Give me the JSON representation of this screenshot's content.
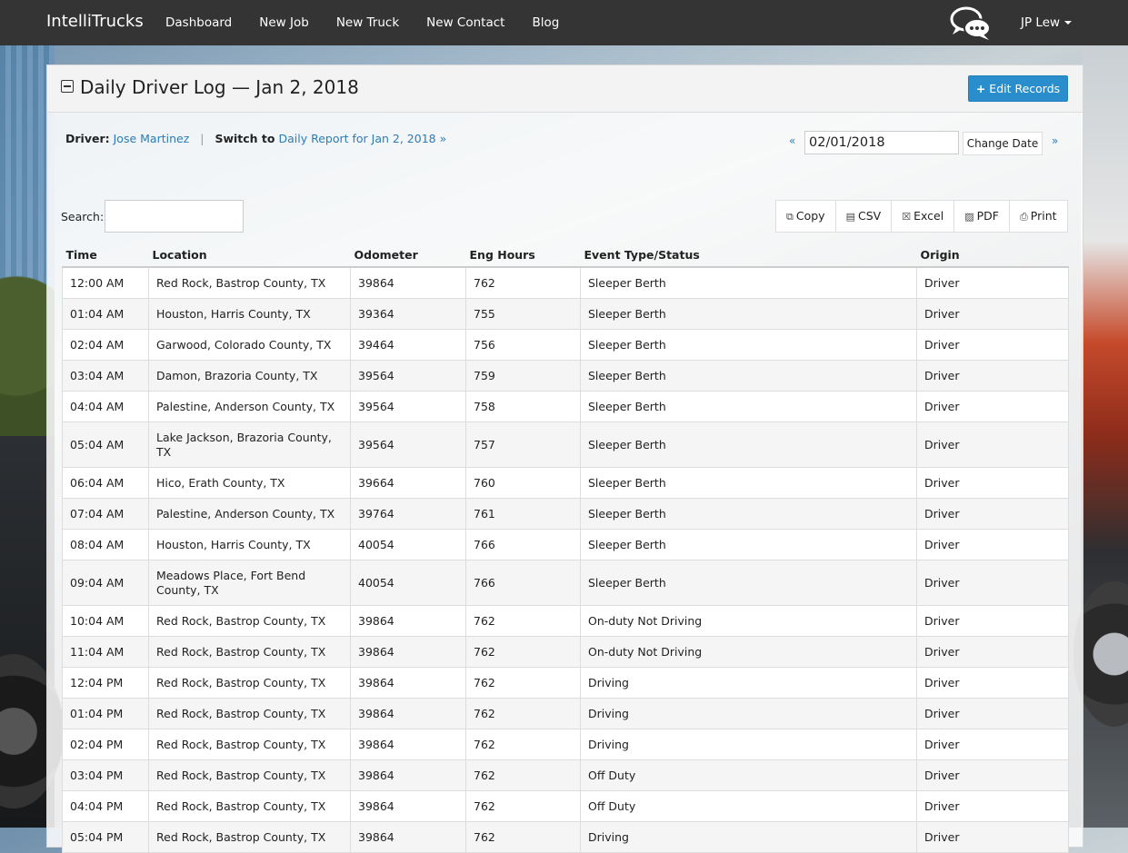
{
  "nav": {
    "brand": "IntelliTrucks",
    "links": [
      "Dashboard",
      "New Job",
      "New Truck",
      "New Contact",
      "Blog"
    ],
    "user": "JP Lew"
  },
  "panel": {
    "title": "Daily Driver Log — Jan 2, 2018",
    "edit_button": "Edit Records"
  },
  "driver": {
    "label": "Driver:",
    "name": "Jose Martinez",
    "switch_label": "Switch to",
    "switch_link": "Daily Report for Jan 2, 2018 »"
  },
  "date_nav": {
    "prev": "«",
    "value": "02/01/2018",
    "change_button": "Change Date",
    "next": "»"
  },
  "search": {
    "label": "Search:"
  },
  "export": [
    "Copy",
    "CSV",
    "Excel",
    "PDF",
    "Print"
  ],
  "table": {
    "columns": [
      "Time",
      "Location",
      "Odometer",
      "Eng Hours",
      "Event Type/Status",
      "Origin"
    ],
    "rows": [
      [
        "12:00 AM",
        "Red Rock, Bastrop County, TX",
        "39864",
        "762",
        "Sleeper Berth",
        "Driver"
      ],
      [
        "01:04 AM",
        "Houston, Harris County, TX",
        "39364",
        "755",
        "Sleeper Berth",
        "Driver"
      ],
      [
        "02:04 AM",
        "Garwood, Colorado County, TX",
        "39464",
        "756",
        "Sleeper Berth",
        "Driver"
      ],
      [
        "03:04 AM",
        "Damon, Brazoria County, TX",
        "39564",
        "759",
        "Sleeper Berth",
        "Driver"
      ],
      [
        "04:04 AM",
        "Palestine, Anderson County, TX",
        "39564",
        "758",
        "Sleeper Berth",
        "Driver"
      ],
      [
        "05:04 AM",
        "Lake Jackson, Brazoria County, TX",
        "39564",
        "757",
        "Sleeper Berth",
        "Driver"
      ],
      [
        "06:04 AM",
        "Hico, Erath County, TX",
        "39664",
        "760",
        "Sleeper Berth",
        "Driver"
      ],
      [
        "07:04 AM",
        "Palestine, Anderson County, TX",
        "39764",
        "761",
        "Sleeper Berth",
        "Driver"
      ],
      [
        "08:04 AM",
        "Houston, Harris County, TX",
        "40054",
        "766",
        "Sleeper Berth",
        "Driver"
      ],
      [
        "09:04 AM",
        "Meadows Place, Fort Bend County, TX",
        "40054",
        "766",
        "Sleeper Berth",
        "Driver"
      ],
      [
        "10:04 AM",
        "Red Rock, Bastrop County, TX",
        "39864",
        "762",
        "On-duty Not Driving",
        "Driver"
      ],
      [
        "11:04 AM",
        "Red Rock, Bastrop County, TX",
        "39864",
        "762",
        "On-duty Not Driving",
        "Driver"
      ],
      [
        "12:04 PM",
        "Red Rock, Bastrop County, TX",
        "39864",
        "762",
        "Driving",
        "Driver"
      ],
      [
        "01:04 PM",
        "Red Rock, Bastrop County, TX",
        "39864",
        "762",
        "Driving",
        "Driver"
      ],
      [
        "02:04 PM",
        "Red Rock, Bastrop County, TX",
        "39864",
        "762",
        "Driving",
        "Driver"
      ],
      [
        "03:04 PM",
        "Red Rock, Bastrop County, TX",
        "39864",
        "762",
        "Off Duty",
        "Driver"
      ],
      [
        "04:04 PM",
        "Red Rock, Bastrop County, TX",
        "39864",
        "762",
        "Off Duty",
        "Driver"
      ],
      [
        "05:04 PM",
        "Red Rock, Bastrop County, TX",
        "39864",
        "762",
        "Driving",
        "Driver"
      ]
    ]
  },
  "icons": {
    "chat": "chat-bubbles-icon",
    "collapse": "minus-square-icon",
    "edit": "plus-icon",
    "copy": "copy-icon",
    "csv": "file-icon",
    "excel": "excel-file-icon",
    "pdf": "pdf-file-icon",
    "print": "print-icon"
  },
  "colors": {
    "navbar": "#343434",
    "primary_button": "#2a8dcc",
    "link": "#2a7db6"
  }
}
